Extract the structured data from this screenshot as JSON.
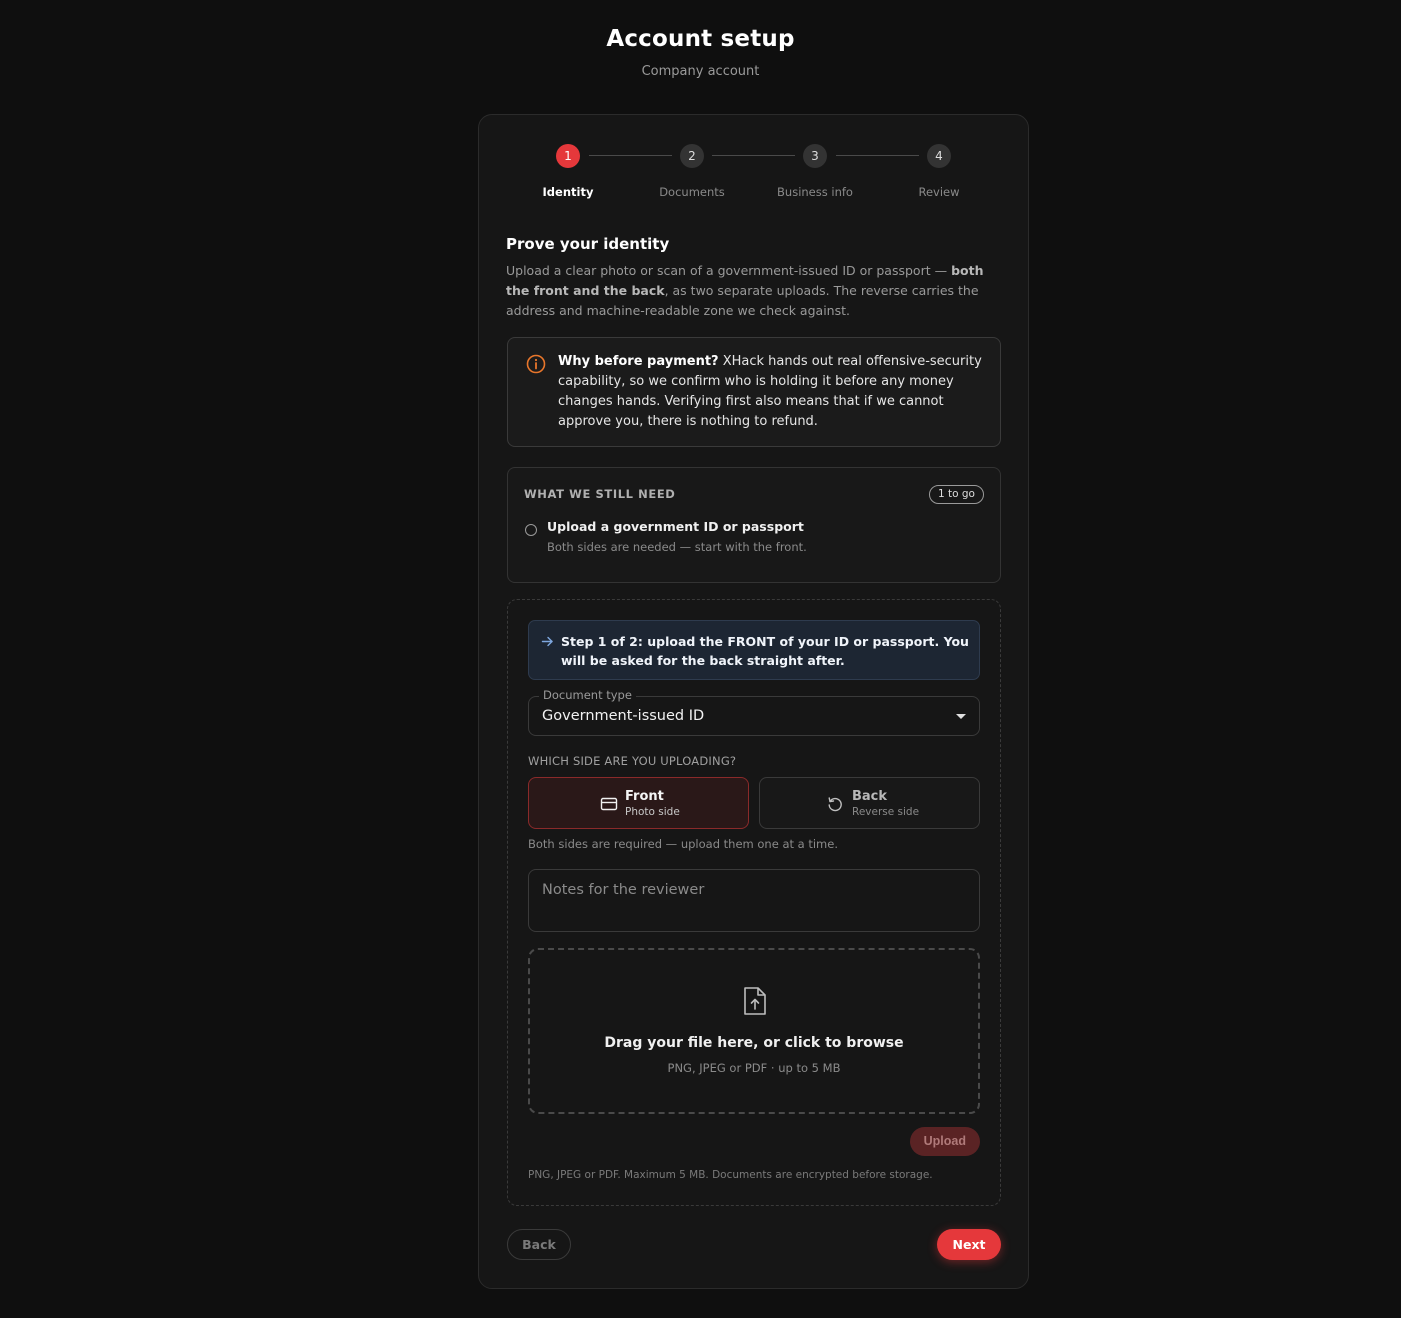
{
  "header": {
    "title": "Account setup",
    "subtitle": "Company account"
  },
  "stepper": {
    "steps": [
      {
        "number": "1",
        "label": "Identity",
        "active": true
      },
      {
        "number": "2",
        "label": "Documents",
        "active": false
      },
      {
        "number": "3",
        "label": "Business info",
        "active": false
      },
      {
        "number": "4",
        "label": "Review",
        "active": false
      }
    ]
  },
  "identity": {
    "title": "Prove your identity",
    "desc_part1": "Upload a clear photo or scan of a government-issued ID or passport — ",
    "desc_bold": "both the front and the back",
    "desc_part2": ", as two separate uploads. The reverse carries the address and machine-readable zone we check against."
  },
  "notice": {
    "icon": "info-circle-icon",
    "bold": "Why before payment?",
    "text": " XHack hands out real offensive-security capability, so we confirm who is holding it before any money changes hands. Verifying first also means that if we cannot approve you, there is nothing to refund.",
    "accent_color": "#e8762b"
  },
  "checklist": {
    "title": "WHAT WE STILL NEED",
    "badge": "1 to go",
    "items": [
      {
        "title": "Upload a government ID or passport",
        "subtitle": "Both sides are needed — start with the front."
      }
    ]
  },
  "upload": {
    "step_notice": "Step 1 of 2: upload the FRONT of your ID or passport. You will be asked for the back straight after.",
    "document_type_label": "Document type",
    "document_type_value": "Government-issued ID",
    "side_question": "WHICH SIDE ARE YOU UPLOADING?",
    "sides": [
      {
        "label": "Front",
        "sub": "Photo side",
        "icon": "card-icon",
        "selected": true
      },
      {
        "label": "Back",
        "sub": "Reverse side",
        "icon": "rotate-icon",
        "selected": false
      }
    ],
    "side_hint": "Both sides are required — upload them one at a time.",
    "notes_placeholder": "Notes for the reviewer",
    "dropzone_title": "Drag your file here, or click to browse",
    "dropzone_sub": "PNG, JPEG or PDF · up to 5 MB",
    "upload_button": "Upload",
    "footnote": "PNG, JPEG or PDF. Maximum 5 MB. Documents are encrypted before storage."
  },
  "nav": {
    "back": "Back",
    "next": "Next"
  },
  "colors": {
    "accent": "#e5383b",
    "background": "#0f0f0f",
    "card": "#161616"
  }
}
